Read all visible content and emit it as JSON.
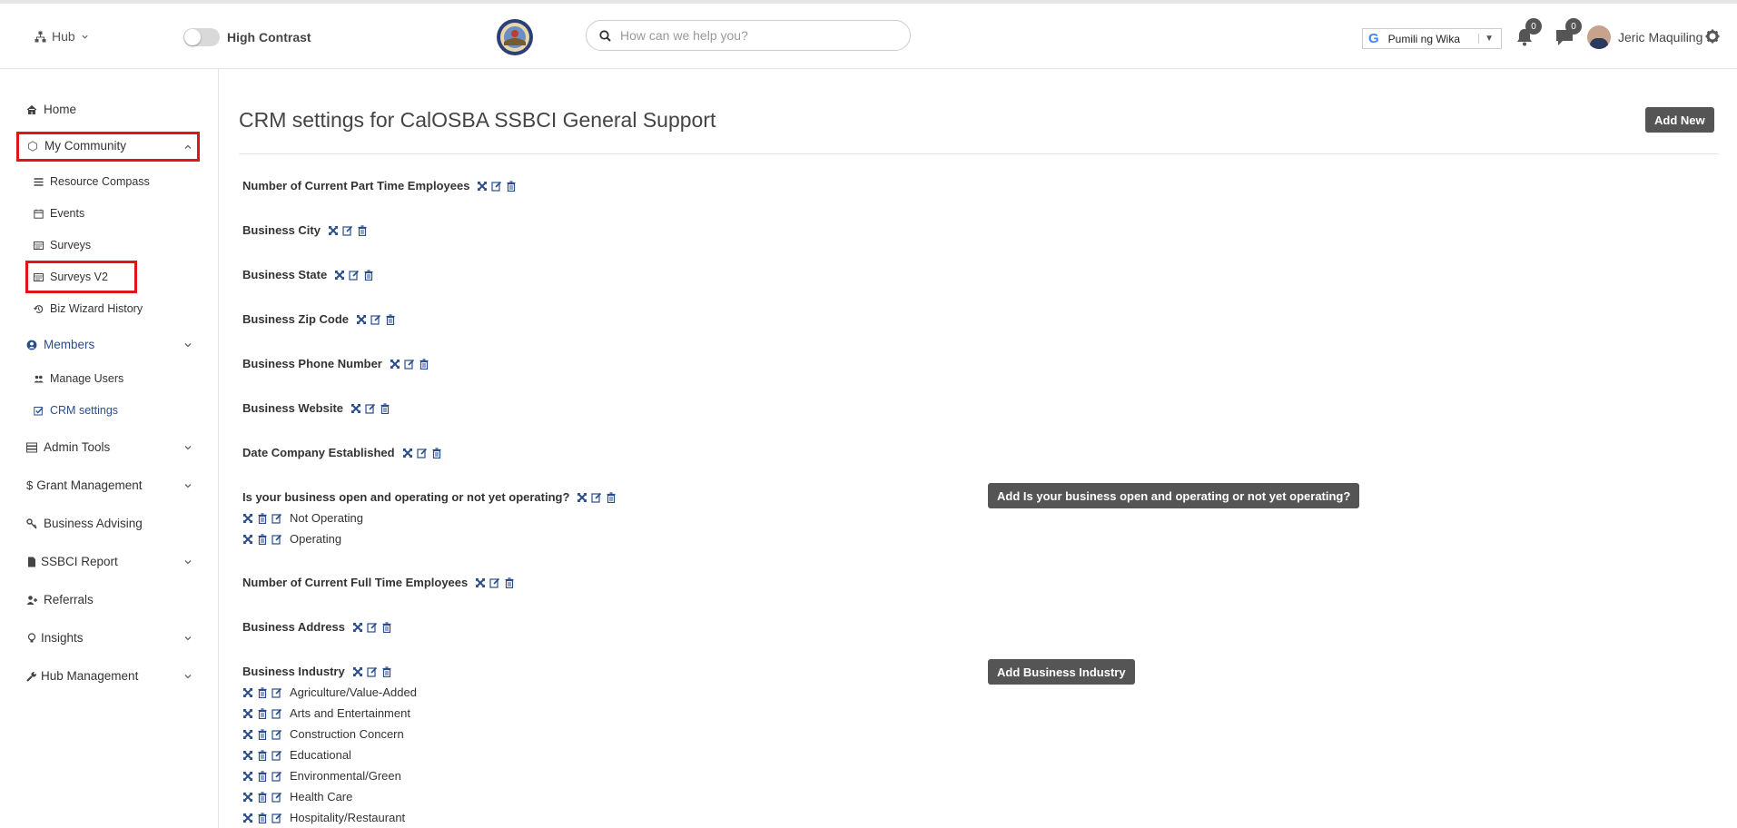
{
  "header": {
    "hub_label": "Hub",
    "high_contrast_label": "High Contrast",
    "search_placeholder": "How can we help you?",
    "language_label": "Pumili ng Wika",
    "notifications_count": "0",
    "messages_count": "0",
    "user_name": "Jeric Maquiling"
  },
  "sidebar": {
    "home": "Home",
    "my_community": "My Community",
    "resource_compass": "Resource Compass",
    "events": "Events",
    "surveys": "Surveys",
    "surveys_v2": "Surveys V2",
    "biz_wizard_history": "Biz Wizard History",
    "members": "Members",
    "manage_users": "Manage Users",
    "crm_settings": "CRM settings",
    "admin_tools": "Admin Tools",
    "grant_management": "Grant Management",
    "business_advising": "Business Advising",
    "ssbci_report": "SSBCI Report",
    "referrals": "Referrals",
    "insights": "Insights",
    "hub_management": "Hub Management"
  },
  "main": {
    "title": "CRM settings for CalOSBA SSBCI General Support",
    "add_new": "Add New",
    "fields": [
      "Number of Current Part Time Employees",
      "Business City",
      "Business State",
      "Business Zip Code",
      "Business Phone Number",
      "Business Website",
      "Date Company Established",
      "Is your business open and operating or not yet operating?",
      "Number of Current Full Time Employees",
      "Business Address",
      "Business Industry"
    ],
    "operating_options": [
      "Not Operating",
      "Operating"
    ],
    "add_operating_button": "Add Is your business open and operating or not yet operating?",
    "industry_options": [
      "Agriculture/Value-Added",
      "Arts and Entertainment",
      "Construction Concern",
      "Educational",
      "Environmental/Green",
      "Health Care",
      "Hospitality/Restaurant"
    ],
    "add_industry_button": "Add Business Industry"
  },
  "colors": {
    "accent_red": "#e0151b",
    "active_blue": "#2a4d8a",
    "dark_button": "#555555"
  }
}
